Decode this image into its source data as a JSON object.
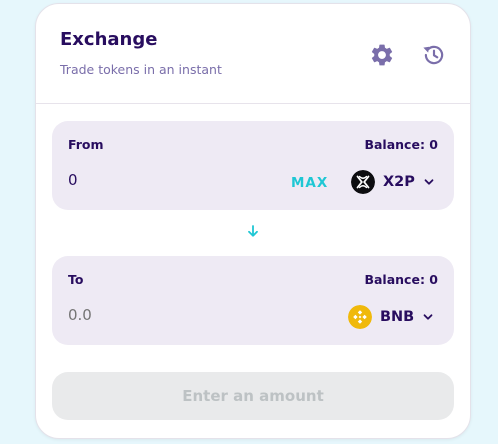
{
  "header": {
    "title": "Exchange",
    "subtitle": "Trade tokens in an instant",
    "settings_icon": "gear-icon",
    "history_icon": "history-icon"
  },
  "from": {
    "label": "From",
    "balance": "Balance: 0",
    "amount": "0",
    "max_label": "MAX",
    "token_symbol": "X2P"
  },
  "swap_icon": "arrow-down-icon",
  "to": {
    "label": "To",
    "balance": "Balance: 0",
    "amount_placeholder": "0.0",
    "token_symbol": "BNB"
  },
  "submit": {
    "label": "Enter an amount"
  },
  "colors": {
    "background": "#e6f7fc",
    "title": "#280d5f",
    "secondary": "#7a6eaa",
    "accent": "#1fc7d4",
    "panel": "#eeeaf4",
    "bnb": "#f0b90b",
    "disabled_bg": "#e9eaeb",
    "disabled_text": "#bdc2c4"
  }
}
